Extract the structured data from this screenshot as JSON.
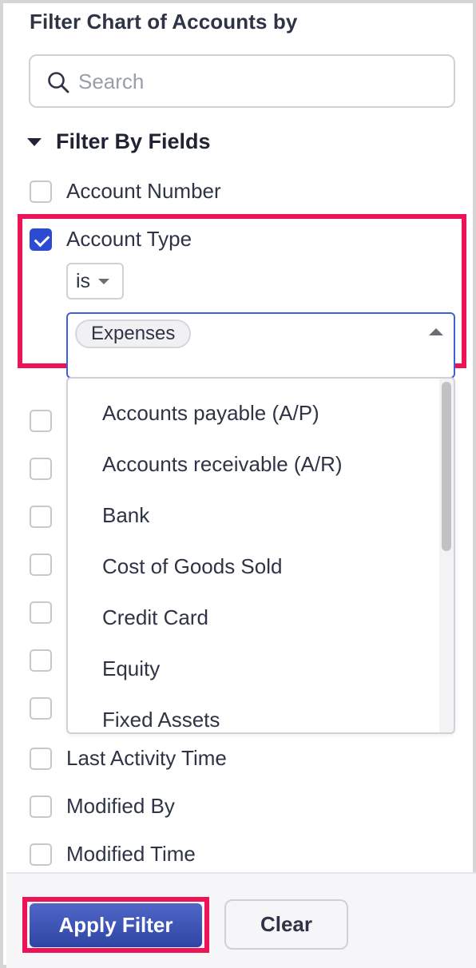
{
  "panel": {
    "title": "Filter Chart of Accounts by"
  },
  "search": {
    "placeholder": "Search",
    "value": ""
  },
  "section": {
    "title": "Filter By Fields",
    "expanded": true
  },
  "fields": {
    "account_number": {
      "label": "Account Number",
      "checked": false
    },
    "account_type": {
      "label": "Account Type",
      "checked": true,
      "operator": "is",
      "selected": [
        "Expenses"
      ]
    },
    "last_activity_time": {
      "label": "Last Activity Time",
      "checked": false
    },
    "modified_by": {
      "label": "Modified By",
      "checked": false
    },
    "modified_time": {
      "label": "Modified Time",
      "checked": false
    }
  },
  "dropdown": {
    "options": [
      "Accounts payable (A/P)",
      "Accounts receivable (A/R)",
      "Bank",
      "Cost of Goods Sold",
      "Credit Card",
      "Equity",
      "Fixed Assets"
    ]
  },
  "footer": {
    "apply_label": "Apply Filter",
    "clear_label": "Clear"
  },
  "colors": {
    "accent": "#2d4bd1",
    "highlight": "#ec1457",
    "text": "#2e3446"
  },
  "icons": {
    "search": "search-icon",
    "section_toggle": "caret-down-icon",
    "dropdown_toggle": "caret-up-icon",
    "operator_toggle": "caret-down-icon"
  }
}
